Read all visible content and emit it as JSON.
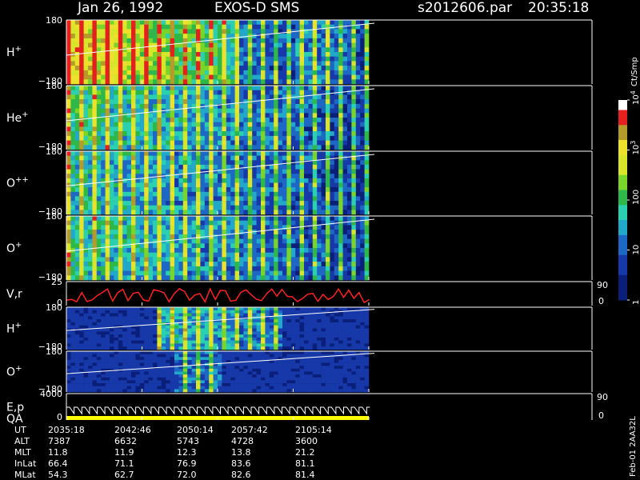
{
  "header": {
    "date": "Jan 26, 1992",
    "instrument": "EXOS-D SMS",
    "file": "s2012606.par",
    "time": "20:35:18"
  },
  "chart_data": {
    "type": "heatmap",
    "x_time_range": [
      "20:35:18",
      "21:05:14"
    ],
    "data_end_label": "21:05:14",
    "panels": [
      {
        "id": "h-plus",
        "label": "H",
        "sup": "+",
        "ytop": "180",
        "ybot": "−180",
        "intensity": 0.65
      },
      {
        "id": "he-plus",
        "label": "He",
        "sup": "+",
        "ytop": "180",
        "ybot": "−180",
        "intensity": 0.35
      },
      {
        "id": "o-plusplus",
        "label": "O",
        "sup": "++",
        "ytop": "180",
        "ybot": "−180",
        "intensity": 0.3
      },
      {
        "id": "o-plus",
        "label": "O",
        "sup": "+",
        "ytop": "180",
        "ybot": "−180",
        "intensity": 0.32
      },
      {
        "id": "vr",
        "label": "V,r",
        "sup": "",
        "ytop": "25",
        "ybot": "0",
        "right_top": "90",
        "right_bot": "0"
      },
      {
        "id": "h-plus-2",
        "label": "H",
        "sup": "+",
        "ytop": "180",
        "ybot": "−180",
        "intensity": 0.38
      },
      {
        "id": "o-plus-2",
        "label": "O",
        "sup": "+",
        "ytop": "180",
        "ybot": "−180",
        "intensity": 0.2
      },
      {
        "id": "ep-qa",
        "label": "E,p",
        "label2": "QA",
        "sup": "",
        "ytop": "4000",
        "ybot": "0",
        "right_top": "90",
        "right_bot": "0"
      }
    ],
    "colorbar": {
      "unit": "Ct/Smp",
      "ticks": [
        {
          "label": "1",
          "value": 1
        },
        {
          "label": "10",
          "value": 10
        },
        {
          "label": "100",
          "value": 100
        },
        {
          "label": "10",
          "sup": "3",
          "value": 1000
        },
        {
          "label": "10",
          "sup": "4",
          "value": 10000
        }
      ]
    },
    "ephemeris": {
      "row_labels": [
        "UT",
        "ALT",
        "MLT",
        "InLat",
        "MLat"
      ],
      "columns": [
        [
          "2035:18",
          "7387",
          "11.8",
          "66.4",
          "54.3"
        ],
        [
          "2042:46",
          "6632",
          "11.9",
          "71.1",
          "62.7"
        ],
        [
          "2050:14",
          "5743",
          "12.3",
          "76.9",
          "72.0"
        ],
        [
          "2057:42",
          "4728",
          "13.8",
          "83.6",
          "82.6"
        ],
        [
          "2105:14",
          "3600",
          "21.2",
          "81.1",
          "81.4"
        ]
      ]
    },
    "side_note": "Feb-01 2AA32L",
    "colors": {
      "axis": "#ffffff",
      "background": "#000000",
      "vr_trace": "#ff2020",
      "qa_bar": "#ffff00"
    }
  }
}
